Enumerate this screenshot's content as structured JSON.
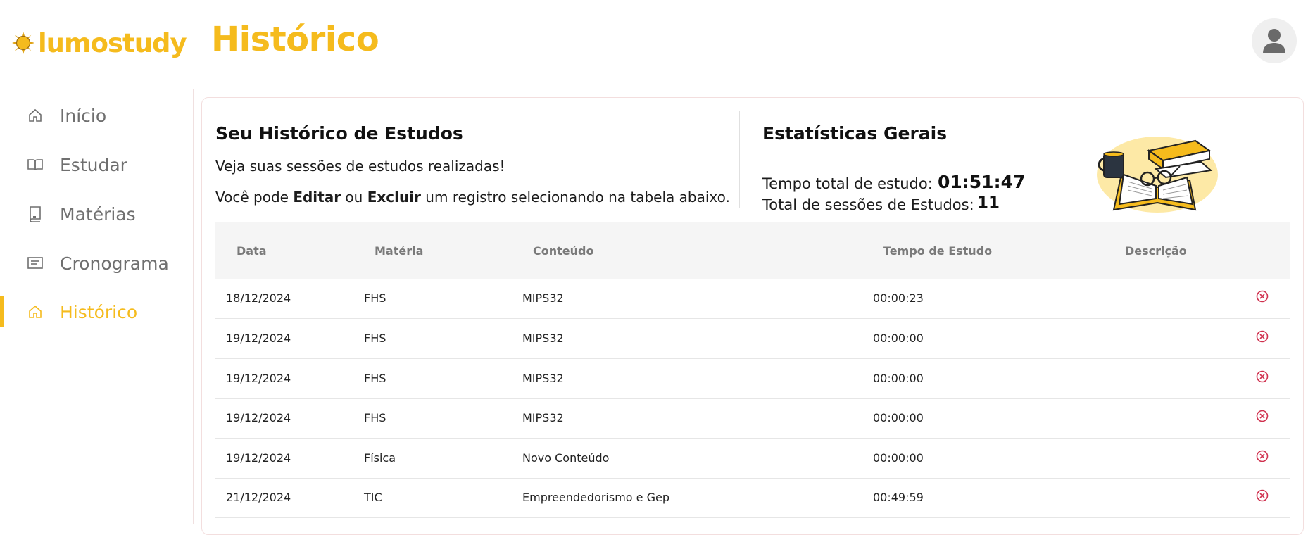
{
  "app": {
    "logo_text": "lumostudy",
    "page_title": "Histórico",
    "brand_color": "#f5bb1d",
    "avatar_icon": "user-avatar-icon"
  },
  "sidebar": {
    "items": [
      {
        "label": "Início",
        "icon": "home-icon",
        "active": false
      },
      {
        "label": "Estudar",
        "icon": "book-open-icon",
        "active": false
      },
      {
        "label": "Matérias",
        "icon": "notebook-icon",
        "active": false
      },
      {
        "label": "Cronograma",
        "icon": "schedule-icon",
        "active": false
      },
      {
        "label": "Histórico",
        "icon": "home-icon",
        "active": true
      }
    ]
  },
  "history": {
    "title": "Seu Histórico de Estudos",
    "subtitle": "Veja suas sessões de estudos realizadas!",
    "hint_prefix": "Você pode ",
    "hint_edit": "Editar",
    "hint_or": " ou ",
    "hint_delete": "Excluir",
    "hint_suffix": " um registro selecionando na tabela abaixo."
  },
  "stats": {
    "title": "Estatísticas Gerais",
    "total_time_label": "Tempo total de estudo:",
    "total_time_value": "01:51:47",
    "total_sessions_label": "Total de sessões de Estudos:",
    "total_sessions_value": "11",
    "illustration": "books-coffee-illustration"
  },
  "table": {
    "headers": [
      "Data",
      "Matéria",
      "Conteúdo",
      "Tempo de Estudo",
      "Descrição"
    ],
    "rows": [
      {
        "date": "18/12/2024",
        "subject": "FHS",
        "content": "MIPS32",
        "time": "00:00:23"
      },
      {
        "date": "19/12/2024",
        "subject": "FHS",
        "content": "MIPS32",
        "time": "00:00:00"
      },
      {
        "date": "19/12/2024",
        "subject": "FHS",
        "content": "MIPS32",
        "time": "00:00:00"
      },
      {
        "date": "19/12/2024",
        "subject": "FHS",
        "content": "MIPS32",
        "time": "00:00:00"
      },
      {
        "date": "19/12/2024",
        "subject": "Física",
        "content": "Novo Conteúdo",
        "time": "00:00:00"
      },
      {
        "date": "21/12/2024",
        "subject": "TIC",
        "content": "Empreendedorismo e Gep",
        "time": "00:49:59"
      }
    ],
    "delete_icon": "close-circle-icon",
    "delete_color": "#d0314f"
  }
}
